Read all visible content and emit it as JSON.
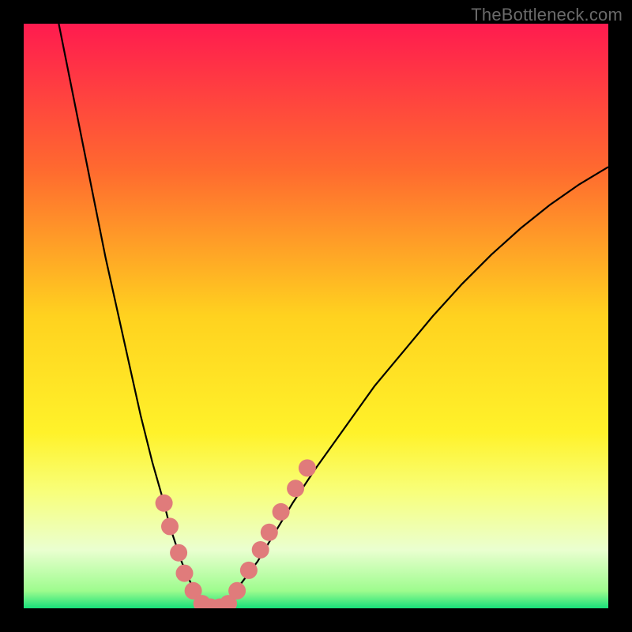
{
  "watermark": "TheBottleneck.com",
  "chart_data": {
    "type": "line",
    "title": "",
    "xlabel": "",
    "ylabel": "",
    "xlim": [
      0,
      100
    ],
    "ylim": [
      0,
      100
    ],
    "background_gradient_stops": [
      {
        "offset": 0.0,
        "color": "#ff1b4f"
      },
      {
        "offset": 0.25,
        "color": "#ff6a2f"
      },
      {
        "offset": 0.5,
        "color": "#ffd21f"
      },
      {
        "offset": 0.7,
        "color": "#fff22a"
      },
      {
        "offset": 0.8,
        "color": "#f8ff7a"
      },
      {
        "offset": 0.9,
        "color": "#eaffd0"
      },
      {
        "offset": 0.97,
        "color": "#9efc8e"
      },
      {
        "offset": 1.0,
        "color": "#18e07a"
      }
    ],
    "series": [
      {
        "name": "curve-left",
        "x": [
          6,
          8,
          10,
          12,
          14,
          16,
          18,
          20,
          22,
          24,
          25,
          26,
          27,
          28,
          29,
          30,
          31,
          32,
          33
        ],
        "y": [
          100,
          90,
          80,
          70,
          60,
          51,
          42,
          33,
          25,
          18,
          14,
          11,
          8,
          5.5,
          3.5,
          2,
          1,
          0.5,
          0
        ]
      },
      {
        "name": "curve-right",
        "x": [
          33,
          35,
          37,
          40,
          43,
          46,
          50,
          55,
          60,
          65,
          70,
          75,
          80,
          85,
          90,
          95,
          100
        ],
        "y": [
          0,
          1.5,
          4,
          8,
          13,
          18,
          24,
          31,
          38,
          44,
          50,
          55.5,
          60.5,
          65,
          69,
          72.5,
          75.5
        ]
      }
    ],
    "markers": {
      "name": "highlight-beads",
      "color": "#e07b7b",
      "radius_px": 11,
      "points_left": [
        {
          "x": 24.0,
          "y": 18.0
        },
        {
          "x": 25.0,
          "y": 14.0
        },
        {
          "x": 26.5,
          "y": 9.5
        },
        {
          "x": 27.5,
          "y": 6.0
        },
        {
          "x": 29.0,
          "y": 3.0
        }
      ],
      "points_bottom": [
        {
          "x": 30.5,
          "y": 0.8
        },
        {
          "x": 32.0,
          "y": 0.2
        },
        {
          "x": 33.5,
          "y": 0.2
        },
        {
          "x": 35.0,
          "y": 0.8
        }
      ],
      "points_right": [
        {
          "x": 36.5,
          "y": 3.0
        },
        {
          "x": 38.5,
          "y": 6.5
        },
        {
          "x": 40.5,
          "y": 10.0
        },
        {
          "x": 42.0,
          "y": 13.0
        },
        {
          "x": 44.0,
          "y": 16.5
        },
        {
          "x": 46.5,
          "y": 20.5
        },
        {
          "x": 48.5,
          "y": 24.0
        }
      ]
    }
  }
}
